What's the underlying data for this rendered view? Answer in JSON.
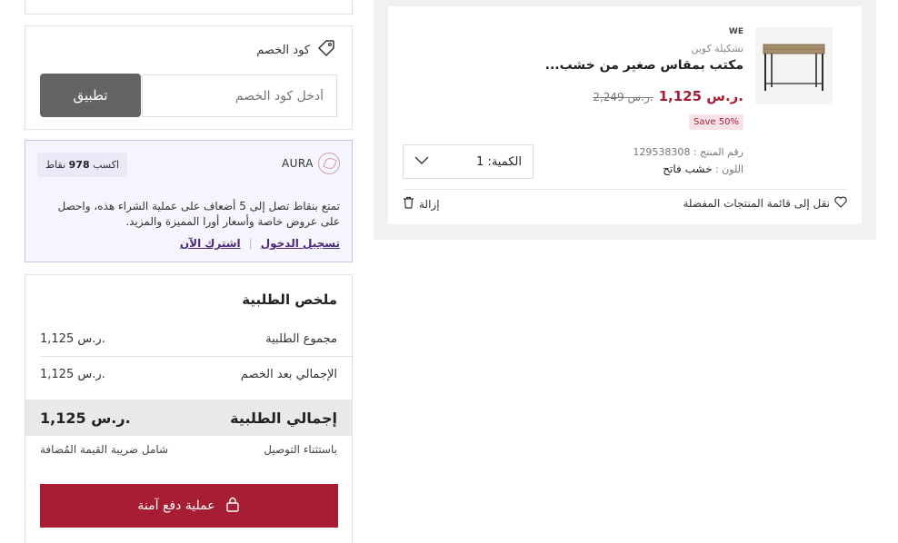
{
  "coupon": {
    "title": "كود الخصم",
    "placeholder": "أدخل كود الخصم",
    "apply_label": "تطبيق"
  },
  "aura": {
    "logo_text": "AURA",
    "earn_prefix": "اكسب",
    "earn_points": "978",
    "earn_suffix": "نقاط",
    "description": "تمتع بنقاط تصل إلى 5 أضعاف على عملية الشراء هذه، واحصل على عروض خاصة وأسعار أورا المميزة والمزيد.",
    "login_label": "تسجيل الدخول",
    "signup_label": "اشترك الآن"
  },
  "summary": {
    "title": "ملخص الطلبية",
    "subtotal_label": "مجموع الطلبية",
    "subtotal_value": "1,125 ر.س.",
    "after_discount_label": "الإجمالي بعد الخصم",
    "after_discount_value": "1,125 ر.س.",
    "total_label": "إجمالي الطلبية",
    "total_value": "1,125 ر.س.",
    "delivery_note": "باستثناء التوصيل",
    "vat_note": "شامل ضريبة القيمة المُضافة",
    "checkout_label": "عملية دفع آمنة"
  },
  "product": {
    "brand": "WE",
    "collection": "تشكيلة كوين",
    "title": "مكتب بمقاس صغير من خشب...",
    "price": "1,125 ر.س.",
    "old_price": "2,249 ر.س.",
    "save_badge": "Save 50%",
    "sku_label": "رقم المنتج :",
    "sku_value": "129538308",
    "color_label": "اللون :",
    "color_value": "خشب فاتح",
    "quantity_label": "الكمية: 1",
    "wishlist_label": "نقل إلى قائمة المنتجات المفضلة",
    "remove_label": "إزالة"
  },
  "colors": {
    "accent": "#a71e34",
    "aura_purple": "#4b2a7a",
    "apply_button": "#646464"
  }
}
